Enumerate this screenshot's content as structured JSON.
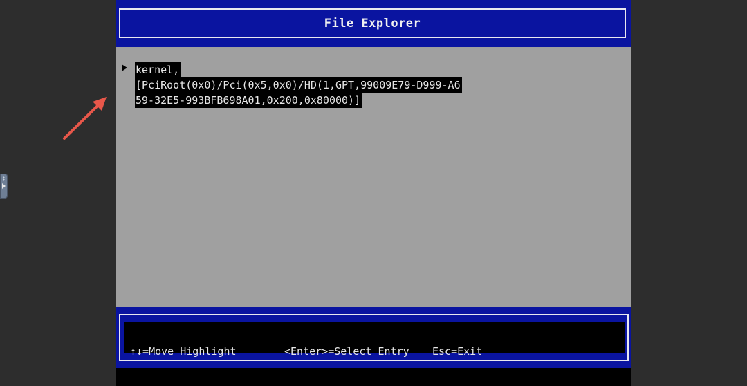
{
  "window": {
    "title": "File Explorer"
  },
  "entries": [
    {
      "lines": [
        "kernel,",
        "[PciRoot(0x0)/Pci(0x5,0x0)/HD(1,GPT,99009E79-D999-A6",
        "59-32E5-993BFB698A01,0x200,0x80000)]"
      ],
      "selected": true
    }
  ],
  "footer": {
    "hints": [
      "↑↓=Move Highlight",
      "<Enter>=Select Entry",
      "Esc=Exit"
    ]
  },
  "colors": {
    "background": "#2d2d2d",
    "header_blue": "#0a14a0",
    "content_gray": "#a0a0a0",
    "highlight": "#000000",
    "text": "#e6e6e6",
    "annotation_arrow": "#e8574a"
  },
  "icons": {
    "pointer": "triangle-right-icon",
    "annotation": "arrow-annotation-icon",
    "sidebar": "sidebar-toggle-icon"
  }
}
